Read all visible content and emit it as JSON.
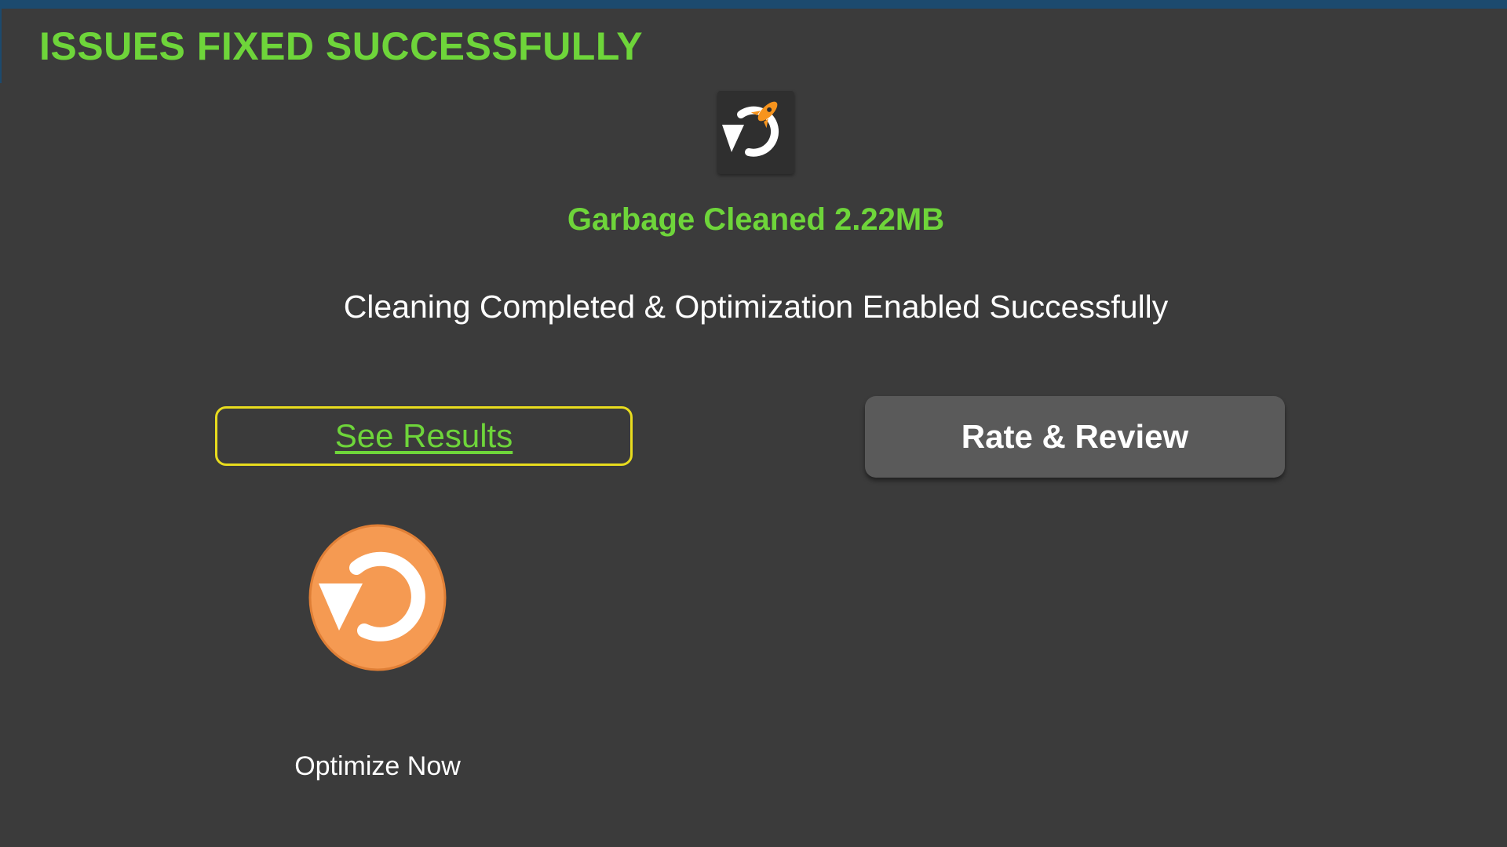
{
  "header": {
    "title": "ISSUES FIXED SUCCESSFULLY"
  },
  "result": {
    "icon": "refresh-rocket-icon",
    "garbage_cleaned": "Garbage Cleaned 2.22MB",
    "status_message": "Cleaning Completed & Optimization Enabled Successfully"
  },
  "actions": {
    "see_results_label": "See Results",
    "rate_review_label": "Rate & Review",
    "optimize_icon": "optimize-refresh-icon",
    "optimize_label": "Optimize Now"
  },
  "colors": {
    "background": "#3b3b3b",
    "accent_green": "#6ed53a",
    "outline_yellow": "#e8dc1e",
    "button_gray": "#5a5a5a",
    "optimize_orange": "#f59a52",
    "rocket_orange": "#f7941d",
    "top_bar": "#1c4a6e"
  }
}
